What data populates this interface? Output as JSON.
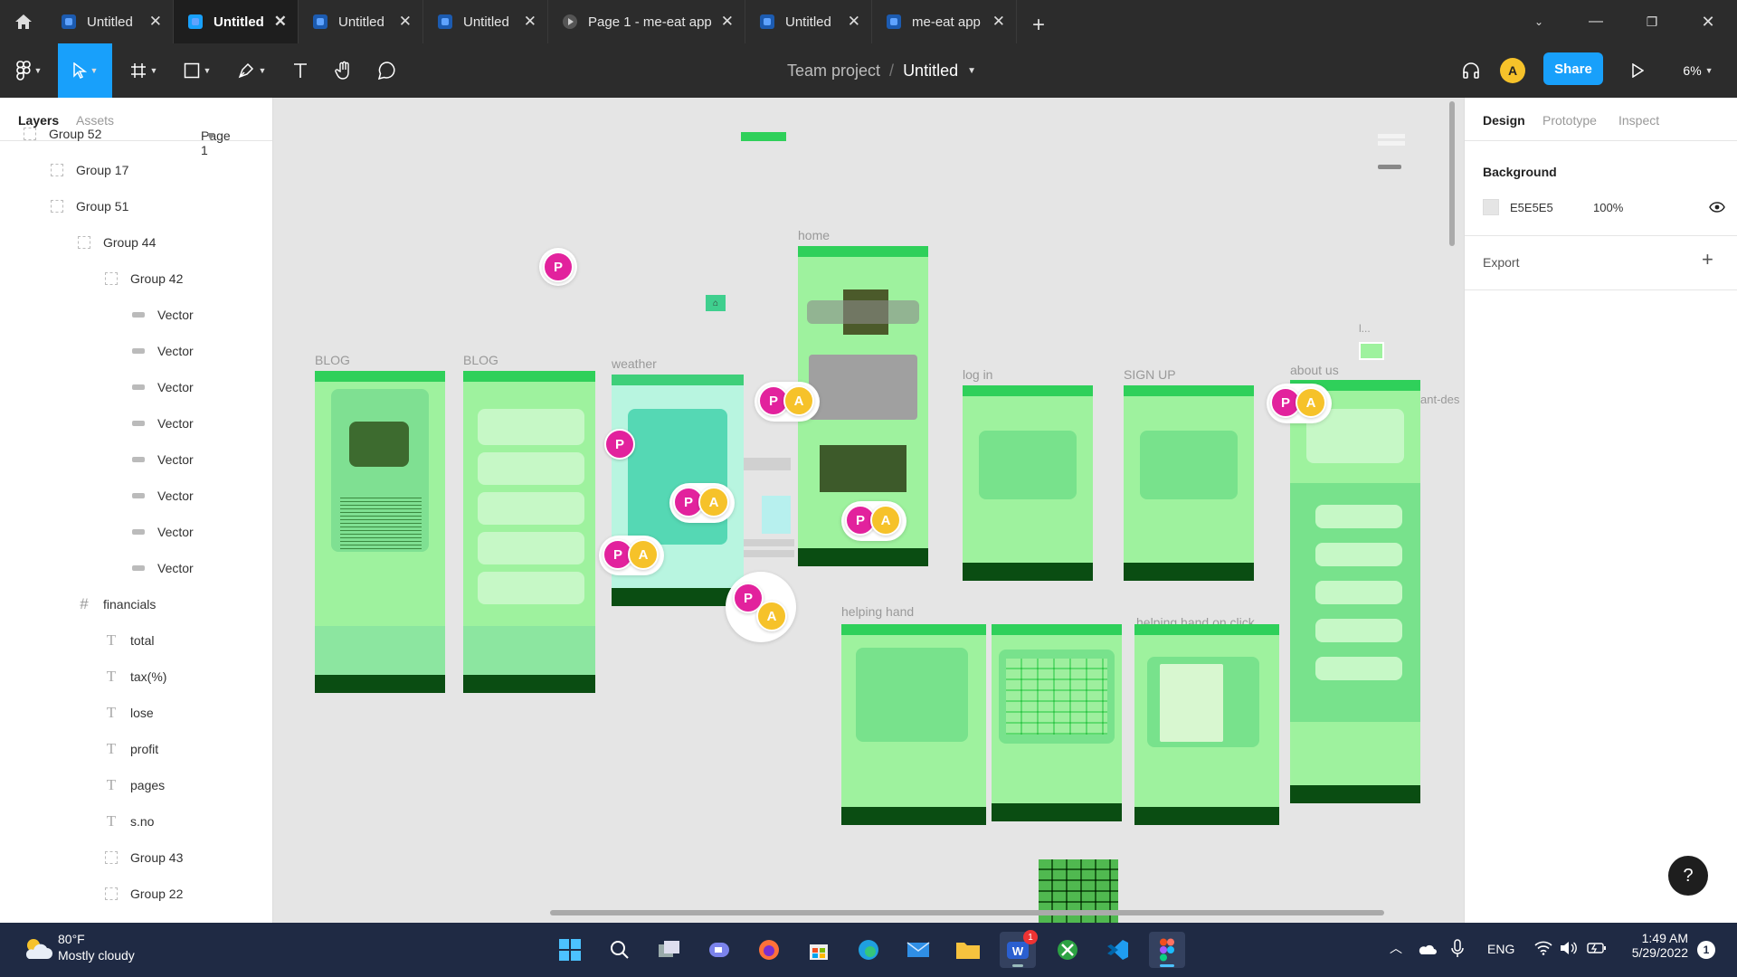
{
  "tabs": [
    {
      "label": "Untitled",
      "kind": "figma",
      "active": false
    },
    {
      "label": "Untitled",
      "kind": "figma",
      "active": true
    },
    {
      "label": "Untitled",
      "kind": "figma",
      "active": false
    },
    {
      "label": "Untitled",
      "kind": "figma",
      "active": false
    },
    {
      "label": "Page 1 - me-eat app",
      "kind": "prototype",
      "active": false
    },
    {
      "label": "Untitled",
      "kind": "figma",
      "active": false
    },
    {
      "label": "me-eat app",
      "kind": "figma",
      "active": false
    }
  ],
  "toolbar": {
    "team": "Team project",
    "separator": "/",
    "file": "Untitled",
    "share": "Share",
    "zoom": "6%",
    "user_initial": "A"
  },
  "left_panel": {
    "tab_layers": "Layers",
    "tab_assets": "Assets",
    "page": "Page 1",
    "layers": [
      {
        "name": "Group 52",
        "type": "group",
        "depth": 0
      },
      {
        "name": "Group 17",
        "type": "group",
        "depth": 1
      },
      {
        "name": "Group 51",
        "type": "group",
        "depth": 1
      },
      {
        "name": "Group 44",
        "type": "group",
        "depth": 2
      },
      {
        "name": "Group 42",
        "type": "group",
        "depth": 3
      },
      {
        "name": "Vector",
        "type": "vector",
        "depth": 4
      },
      {
        "name": "Vector",
        "type": "vector",
        "depth": 4
      },
      {
        "name": "Vector",
        "type": "vector",
        "depth": 4
      },
      {
        "name": "Vector",
        "type": "vector",
        "depth": 4
      },
      {
        "name": "Vector",
        "type": "vector",
        "depth": 4
      },
      {
        "name": "Vector",
        "type": "vector",
        "depth": 4
      },
      {
        "name": "Vector",
        "type": "vector",
        "depth": 4
      },
      {
        "name": "Vector",
        "type": "vector",
        "depth": 4
      },
      {
        "name": "financials",
        "type": "frame",
        "depth": 2
      },
      {
        "name": "total",
        "type": "text",
        "depth": 3
      },
      {
        "name": "tax(%)",
        "type": "text",
        "depth": 3
      },
      {
        "name": "lose",
        "type": "text",
        "depth": 3
      },
      {
        "name": "profit",
        "type": "text",
        "depth": 3
      },
      {
        "name": "pages",
        "type": "text",
        "depth": 3
      },
      {
        "name": "s.no",
        "type": "text",
        "depth": 3
      },
      {
        "name": "Group 43",
        "type": "group",
        "depth": 3
      },
      {
        "name": "Group 22",
        "type": "group",
        "depth": 3
      }
    ]
  },
  "canvas": {
    "frame_labels": {
      "blog1": "BLOG",
      "blog2": "BLOG",
      "weather": "weather",
      "home": "home",
      "login": "log in",
      "signup": "SIGN UP",
      "about": "about us",
      "helping": "helping hand",
      "helping_click": "helping hand on click",
      "ant": "ant-des",
      "dots": "l..."
    },
    "cursor_p": "P",
    "cursor_a": "A"
  },
  "right_panel": {
    "tab_design": "Design",
    "tab_prototype": "Prototype",
    "tab_inspect": "Inspect",
    "background_heading": "Background",
    "bg_hex": "E5E5E5",
    "bg_opacity": "100%",
    "export_heading": "Export"
  },
  "taskbar": {
    "temp": "80°F",
    "weather": "Mostly cloudy",
    "lang": "ENG",
    "time": "1:49 AM",
    "date": "5/29/2022",
    "notif_count": "1",
    "badge": "1"
  },
  "colors": {
    "accent": "#18a0fb",
    "frame_green": "#9ef29e",
    "header_green": "#2fd05a",
    "footer_green": "#0a4d12",
    "cursor_pink": "#e2229d",
    "cursor_yellow": "#f6c22a"
  }
}
